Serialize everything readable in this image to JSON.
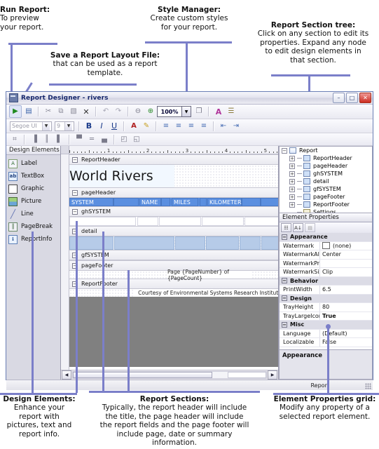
{
  "callouts": {
    "run_report": {
      "title": "Run Report:",
      "body": "To preview\nyour report."
    },
    "save_layout": {
      "title": "Save a Report Layout File:",
      "body": "that can be used as a report\ntemplate."
    },
    "style_manager": {
      "title": "Style Manager:",
      "body": "Create custom styles\nfor your report."
    },
    "report_tree": {
      "title": "Report Section tree:",
      "body": "Click on any section to edit its\nproperties.  Expand any node\nto edit design elements in\nthat section."
    },
    "design_elements": {
      "title": "Design Elements:",
      "body": "Enhance your\nreport with\npictures, text and\nreport info."
    },
    "report_sections": {
      "title": "Report Sections:",
      "body": "Typically, the report header will include\nthe title, the page header will include\nthe report fields and the page footer will\ninclude page, date or summary\ninformation."
    },
    "properties_grid": {
      "title": "Element Properties grid:",
      "body": "Modify any property of a\nselected report element."
    }
  },
  "window": {
    "title": "Report Designer - rivers",
    "icon": "report-designer-icon",
    "minimize": "–",
    "maximize": "□",
    "close": "✕"
  },
  "toolbar": {
    "row1": [
      {
        "name": "run-report-button",
        "glyph": "▶",
        "color": "#1f8a1f"
      },
      {
        "name": "save-report-layout-button",
        "glyph": "▤",
        "color": "#3a62a8"
      },
      {
        "name": "cut-button",
        "glyph": "✂",
        "color": "#707080"
      },
      {
        "name": "copy-button",
        "glyph": "⧉",
        "color": "#707080"
      },
      {
        "name": "paste-button",
        "glyph": "▧",
        "color": "#707080"
      },
      {
        "name": "delete-button",
        "glyph": "✕",
        "color": "#444"
      },
      {
        "name": "undo-button",
        "glyph": "↶",
        "color": "#9a9aa8"
      },
      {
        "name": "redo-button",
        "glyph": "↷",
        "color": "#9a9aa8"
      },
      {
        "name": "zoom-out-button",
        "glyph": "⊖",
        "color": "#6a6a7a"
      },
      {
        "name": "zoom-in-button",
        "glyph": "⊕",
        "color": "#2a8a2a"
      },
      {
        "name": "page-setup-button",
        "glyph": "❐",
        "color": "#6a6a7a"
      },
      {
        "name": "style-manager-button",
        "glyph": "A",
        "color": "#b0359b"
      },
      {
        "name": "report-properties-button",
        "glyph": "☰",
        "color": "#7a6a3a"
      }
    ],
    "zoom_value": "100%",
    "zoom_dropdown_icon": "chevron-down-icon",
    "font_family": "Segoe UI",
    "font_size": "9",
    "row2": [
      {
        "name": "bold-button",
        "glyph": "B"
      },
      {
        "name": "italic-button",
        "glyph": "I"
      },
      {
        "name": "underline-button",
        "glyph": "U"
      },
      {
        "name": "font-color-button",
        "glyph": "A"
      },
      {
        "name": "highlight-color-button",
        "glyph": "✎"
      },
      {
        "name": "align-left-button",
        "glyph": "≡"
      },
      {
        "name": "align-center-button",
        "glyph": "≡"
      },
      {
        "name": "align-right-button",
        "glyph": "≡"
      },
      {
        "name": "align-justify-button",
        "glyph": "≡"
      },
      {
        "name": "decrease-indent-button",
        "glyph": "⇤"
      },
      {
        "name": "increase-indent-button",
        "glyph": "⇥"
      }
    ],
    "row3": [
      {
        "name": "group-button",
        "glyph": "⌗"
      },
      {
        "name": "align-left-edges-button",
        "glyph": "▐"
      },
      {
        "name": "align-center-vertical-button",
        "glyph": "║"
      },
      {
        "name": "align-right-edges-button",
        "glyph": "▌"
      },
      {
        "name": "align-top-edges-button",
        "glyph": "▀"
      },
      {
        "name": "align-middle-button",
        "glyph": "═"
      },
      {
        "name": "align-bottom-edges-button",
        "glyph": "▄"
      },
      {
        "name": "bring-to-front-button",
        "glyph": "◰"
      },
      {
        "name": "send-to-back-button",
        "glyph": "◱"
      }
    ]
  },
  "design_elements_panel": {
    "header": "Design Elements",
    "items": [
      {
        "label": "Label",
        "icon": "label-icon",
        "glyph": "A"
      },
      {
        "label": "TextBox",
        "icon": "textbox-icon",
        "glyph": "ab"
      },
      {
        "label": "Graphic",
        "icon": "graphic-icon",
        "glyph": ""
      },
      {
        "label": "Picture",
        "icon": "picture-icon",
        "glyph": ""
      },
      {
        "label": "Line",
        "icon": "line-icon",
        "glyph": "╱"
      },
      {
        "label": "PageBreak",
        "icon": "pagebreak-icon",
        "glyph": "║"
      },
      {
        "label": "ReportInfo",
        "icon": "reportinfo-icon",
        "glyph": "ℹ"
      }
    ]
  },
  "ruler": {
    "marks": [
      "1",
      "2",
      "3",
      "4",
      "5"
    ]
  },
  "canvas": {
    "bands": [
      {
        "name": "ReportHeader",
        "label": "ReportHeader"
      },
      {
        "name": "pageHeader",
        "label": "pageHeader"
      },
      {
        "name": "ghSYSTEM",
        "label": "ghSYSTEM"
      },
      {
        "name": "detail",
        "label": "detail"
      },
      {
        "name": "gfSYSTEM",
        "label": "gfSYSTEM"
      },
      {
        "name": "pageFooter",
        "label": "pageFooter"
      },
      {
        "name": "ReportFooter",
        "label": "ReportFooter"
      }
    ],
    "report_title": "World Rivers",
    "column_headers": [
      "SYSTEM",
      "NAME",
      "MILES",
      "KILOMETERS"
    ],
    "page_footer_text": "Page {PageNumber} of {PageCount}",
    "report_footer_text": "Courtesy of Environmental Systems Research Institute",
    "hscroll_left_icon": "arrow-left-icon",
    "hscroll_right_icon": "arrow-right-icon"
  },
  "tree": {
    "nodes": [
      {
        "label": "Report",
        "depth": 0,
        "expander": "−",
        "icon": "report-doc-icon"
      },
      {
        "label": "ReportHeader",
        "depth": 1,
        "expander": "+",
        "icon": "band-icon"
      },
      {
        "label": "pageHeader",
        "depth": 1,
        "expander": "+",
        "icon": "band-icon"
      },
      {
        "label": "ghSYSTEM",
        "depth": 1,
        "expander": "+",
        "icon": "band-icon"
      },
      {
        "label": "detail",
        "depth": 1,
        "expander": "+",
        "icon": "band-icon"
      },
      {
        "label": "gfSYSTEM",
        "depth": 1,
        "expander": "+",
        "icon": "band-icon"
      },
      {
        "label": "pageFooter",
        "depth": 1,
        "expander": "+",
        "icon": "band-icon"
      },
      {
        "label": "ReportFooter",
        "depth": 1,
        "expander": "+",
        "icon": "band-icon"
      },
      {
        "label": "Settings",
        "depth": 1,
        "expander": "",
        "icon": "settings-icon"
      }
    ]
  },
  "properties": {
    "header": "Element Properties",
    "toolbar": [
      {
        "name": "categorized-view-button",
        "glyph": "☷"
      },
      {
        "name": "alphabetical-sort-button",
        "glyph": "A↓"
      },
      {
        "name": "property-pages-button",
        "glyph": "▤"
      }
    ],
    "rows": [
      {
        "type": "category",
        "name": "Appearance"
      },
      {
        "type": "prop",
        "name": "Watermark",
        "value": "(none)",
        "swatch": "#ffffff"
      },
      {
        "type": "prop",
        "name": "WatermarkAlignm",
        "value": "Center"
      },
      {
        "type": "prop",
        "name": "WatermarkPrintO",
        "value": ""
      },
      {
        "type": "prop",
        "name": "WatermarkSizeM",
        "value": "Clip"
      },
      {
        "type": "category",
        "name": "Behavior"
      },
      {
        "type": "prop",
        "name": "PrintWidth",
        "value": "6.5"
      },
      {
        "type": "category",
        "name": "Design"
      },
      {
        "type": "prop",
        "name": "TrayHeight",
        "value": "80"
      },
      {
        "type": "prop",
        "name": "TrayLargeIcon",
        "value": "True",
        "bold": true
      },
      {
        "type": "category",
        "name": "Misc"
      },
      {
        "type": "prop",
        "name": "Language",
        "value": "(Default)"
      },
      {
        "type": "prop",
        "name": "Localizable",
        "value": "False"
      }
    ],
    "description": "Appearance"
  },
  "statusbar": {
    "text": "Report"
  }
}
